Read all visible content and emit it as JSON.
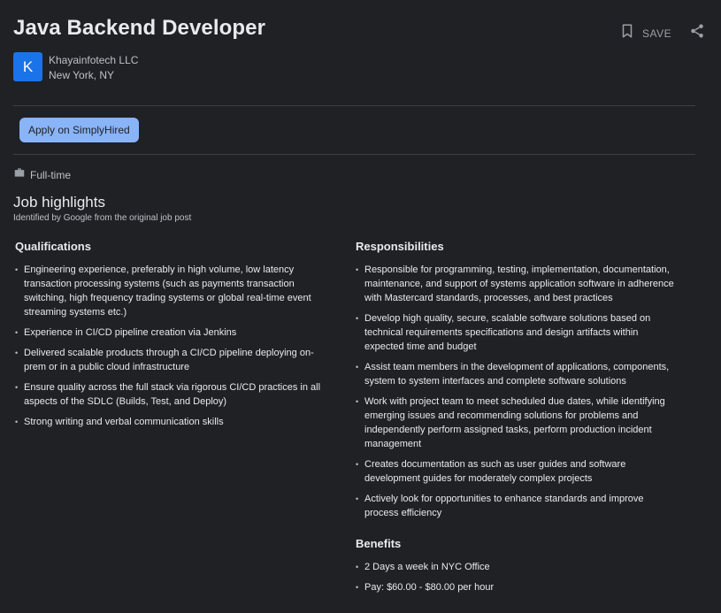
{
  "job": {
    "title": "Java Backend Developer",
    "save_label": "SAVE",
    "avatar_letter": "K",
    "company": "Khayainfotech LLC",
    "location": "New York, NY",
    "apply_label": "Apply on SimplyHired",
    "job_type": "Full-time"
  },
  "highlights": {
    "title": "Job highlights",
    "subtitle": "Identified by Google from the original job post",
    "qualifications": {
      "title": "Qualifications",
      "items": [
        "Engineering experience, preferably in high volume, low latency transaction processing systems (such as payments transaction switching, high frequency trading systems or global real-time event streaming systems etc.)",
        "Experience in CI/CD pipeline creation via Jenkins",
        "Delivered scalable products through a CI/CD pipeline deploying on-prem or in a public cloud infrastructure",
        "Ensure quality across the full stack via rigorous CI/CD practices in all aspects of the SDLC (Builds, Test, and Deploy)",
        "Strong writing and verbal communication skills"
      ]
    },
    "responsibilities": {
      "title": "Responsibilities",
      "items": [
        "Responsible for programming, testing, implementation, documentation, maintenance, and support of systems application software in adherence with Mastercard standards, processes, and best practices",
        "Develop high quality, secure, scalable software solutions based on technical requirements specifications and design artifacts within expected time and budget",
        "Assist team members in the development of applications, components, system to system interfaces and complete software solutions",
        "Work with project team to meet scheduled due dates, while identifying emerging issues and recommending solutions for problems and independently perform assigned tasks, perform production incident management",
        "Creates documentation as such as user guides and software development guides for moderately complex projects",
        "Actively look for opportunities to enhance standards and improve process efficiency"
      ]
    },
    "benefits": {
      "title": "Benefits",
      "items": [
        "2 Days a week in NYC Office",
        "Pay: $60.00 - $80.00 per hour"
      ]
    }
  },
  "icons": {
    "save": "bookmark-icon",
    "share": "share-icon",
    "job_type": "briefcase-icon"
  },
  "colors": {
    "background": "#202124",
    "apply_button": "#8ab4f8",
    "avatar": "#1a73e8"
  }
}
